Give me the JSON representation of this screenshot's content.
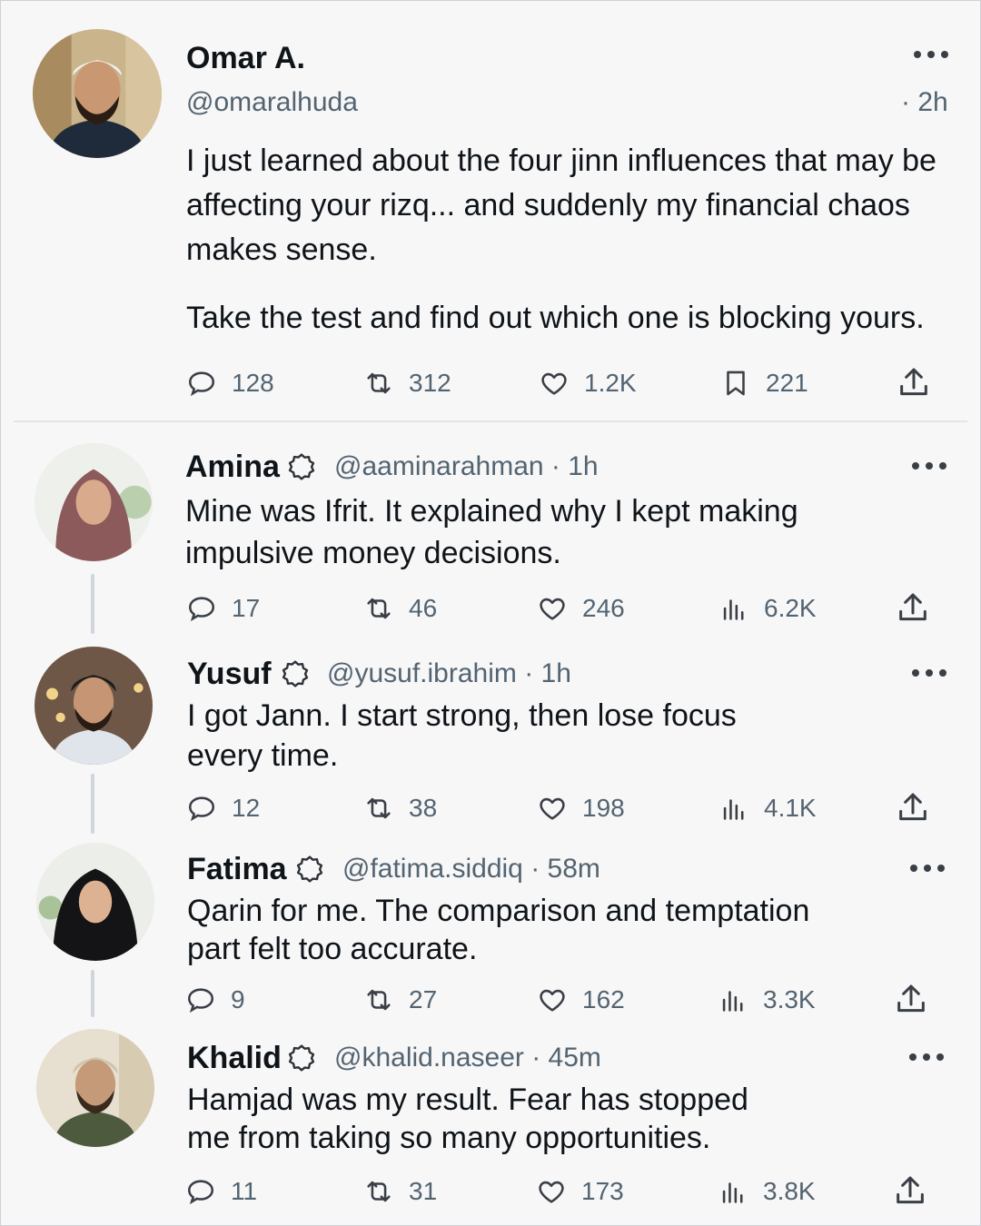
{
  "main_post": {
    "name": "Omar A.",
    "handle": "@omaralhuda",
    "time": "· 2h",
    "text_p1": "I just learned about the four jinn influences that may be affecting your rizq... and suddenly my financial chaos makes sense.",
    "text_p2": "Take the test and find out which one is blocking yours.",
    "replies": "128",
    "reposts": "312",
    "likes": "1.2K",
    "bookmarks": "221"
  },
  "replies": [
    {
      "name": "Amina",
      "handle": "@aaminarahman · 1h",
      "text": "Mine was Ifrit. It explained why I kept making impulsive money decisions.",
      "replies": "17",
      "reposts": "46",
      "likes": "246",
      "views": "6.2K"
    },
    {
      "name": "Yusuf",
      "handle": "@yusuf.ibrahim · 1h",
      "text": "I got Jann. I start strong, then lose focus every time.",
      "replies": "12",
      "reposts": "38",
      "likes": "198",
      "views": "4.1K"
    },
    {
      "name": "Fatima",
      "handle": "@fatima.siddiq · 58m",
      "text": "Qarin for me. The comparison and temptation part felt too accurate.",
      "replies": "9",
      "reposts": "27",
      "likes": "162",
      "views": "3.3K"
    },
    {
      "name": "Khalid",
      "handle": "@khalid.naseer · 45m",
      "text": "Hamjad was my result. Fear has stopped me from taking so many opportunities.",
      "replies": "11",
      "reposts": "31",
      "likes": "173",
      "views": "3.8K"
    }
  ],
  "icons": {
    "reply": "speech-bubble-icon",
    "repost": "repost-arrows-icon",
    "like": "heart-icon",
    "bookmark": "bookmark-icon",
    "views": "bar-chart-icon",
    "share": "share-upload-icon",
    "verified": "verified-badge-icon",
    "more": "more-dots-icon"
  },
  "colors": {
    "background": "#f7f7f8",
    "text": "#0f1419",
    "secondary": "#536471"
  }
}
